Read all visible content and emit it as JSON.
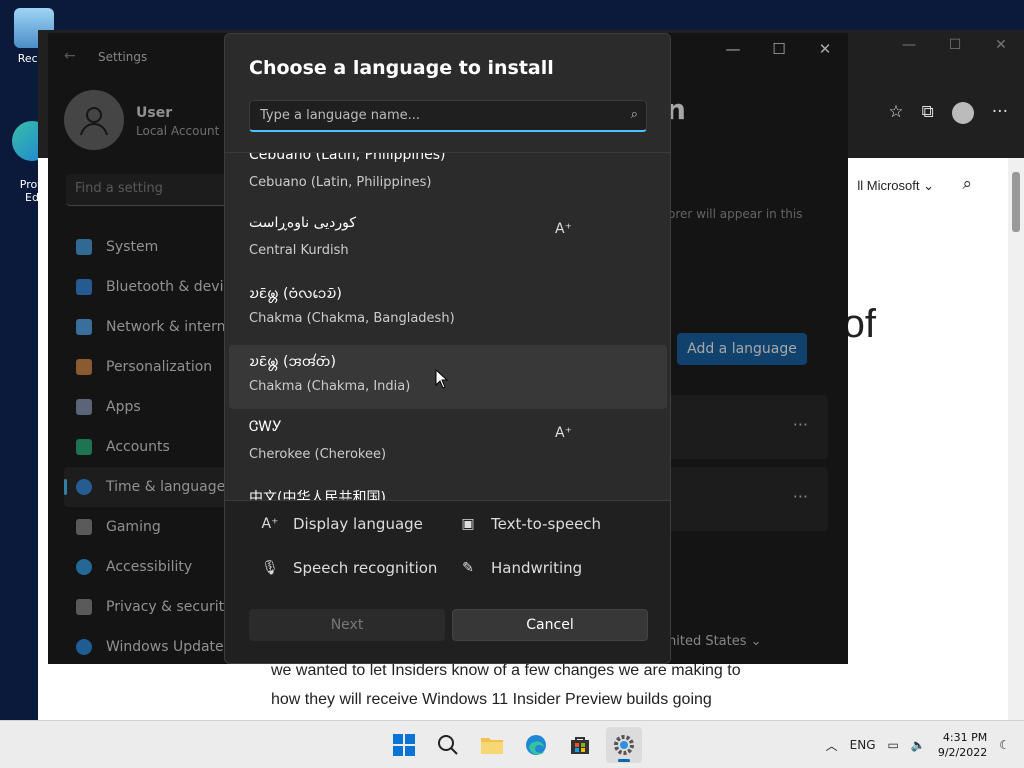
{
  "desktop": {
    "icons": [
      {
        "label": "Recyc"
      },
      {
        "label": "Profi\nEd"
      }
    ]
  },
  "browser": {
    "toolbar_icons": [
      "favorites-star-icon",
      "collections-icon",
      "profile-icon",
      "more-icon"
    ],
    "all_microsoft": "ll Microsoft",
    "page_text_1": "we wanted to let Insiders know of a few changes we are making to",
    "page_text_2": "how they will receive Windows 11 Insider Preview builds going",
    "big_text": "of"
  },
  "settings": {
    "title": "Settings",
    "account_name": "User",
    "account_type": "Local Account",
    "find_placeholder": "Find a setting",
    "heading_tail": "n",
    "hint": "orer will appear in this",
    "add_language": "Add a language",
    "region": "nited States",
    "nav": [
      {
        "label": "System",
        "color": "#4aa3e0"
      },
      {
        "label": "Bluetooth & devices",
        "color": "#3b8de0"
      },
      {
        "label": "Network & internet",
        "color": "#5aa9f0"
      },
      {
        "label": "Personalization",
        "color": "#d58b4a"
      },
      {
        "label": "Apps",
        "color": "#8a9bb8"
      },
      {
        "label": "Accounts",
        "color": "#2db37d"
      },
      {
        "label": "Time & language",
        "color": "#3c8ee0"
      },
      {
        "label": "Gaming",
        "color": "#8a8a8a"
      },
      {
        "label": "Accessibility",
        "color": "#3aa0e8"
      },
      {
        "label": "Privacy & security",
        "color": "#8a8a8a"
      },
      {
        "label": "Windows Update",
        "color": "#2f8fe0"
      }
    ]
  },
  "dialog": {
    "title": "Choose a language to install",
    "search_placeholder": "Type a language name...",
    "languages": [
      {
        "native": "Cebuano (Latin, Philippines)",
        "english": "Cebuano (Latin, Philippines)",
        "badge": ""
      },
      {
        "native": "کوردیی ناوەڕاست",
        "english": "Central Kurdish",
        "badge": "A⁺"
      },
      {
        "native": "𑄌𑄋𑄴𑄟𑄳𑄦 (𑄝𑄁𑄣𑄘𑄬𑄌𑄴)",
        "english": "Chakma (Chakma, Bangladesh)",
        "badge": ""
      },
      {
        "native": "𑄌𑄋𑄴𑄟𑄳𑄦 (𑄞𑄢𑄧𑄖𑄴)",
        "english": "Chakma (Chakma, India)",
        "badge": ""
      },
      {
        "native": "ᏣᎳᎩ",
        "english": "Cherokee (Cherokee)",
        "badge": "A⁺"
      },
      {
        "native": "中文(中华人民共和国)",
        "english": "",
        "badge": ""
      }
    ],
    "features": [
      {
        "label": "Display language",
        "icon": "display-language-icon"
      },
      {
        "label": "Text-to-speech",
        "icon": "text-to-speech-icon"
      },
      {
        "label": "Speech recognition",
        "icon": "microphone-icon"
      },
      {
        "label": "Handwriting",
        "icon": "handwriting-icon"
      }
    ],
    "next_label": "Next",
    "cancel_label": "Cancel"
  },
  "taskbar": {
    "language": "ENG",
    "time": "4:31 PM",
    "date": "9/2/2022"
  }
}
